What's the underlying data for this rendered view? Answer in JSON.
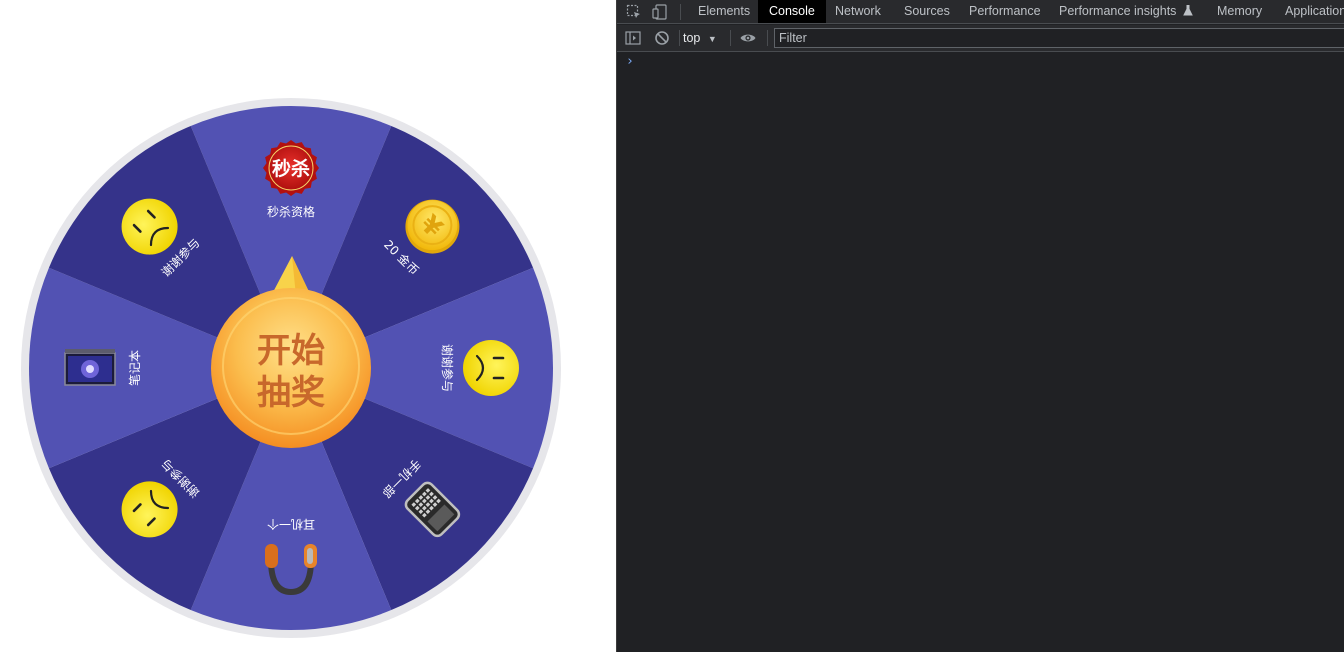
{
  "wheel": {
    "start_button_line1": "开始",
    "start_button_line2": "抽奖",
    "prizes": [
      {
        "label": "秒杀资格",
        "icon": "miaosha-badge-icon",
        "badge_text": "秒杀"
      },
      {
        "label": "20 金币",
        "icon": "gold-coin-icon",
        "coin_symbol": "¥"
      },
      {
        "label": "谢谢参与",
        "icon": "sad-face-icon"
      },
      {
        "label": "手机一部",
        "icon": "phone-icon"
      },
      {
        "label": "耳机一个",
        "icon": "headphones-icon"
      },
      {
        "label": "谢谢参与",
        "icon": "sad-face-icon"
      },
      {
        "label": "笔记本",
        "icon": "laptop-icon"
      },
      {
        "label": "谢谢参与",
        "icon": "sad-face-icon"
      }
    ],
    "colors": {
      "sector_light": "#5252b3",
      "sector_dark": "#35338a",
      "rim": "#e6e6ea",
      "button_orange": "#f9a53b",
      "button_text": "#c8682b"
    }
  },
  "devtools": {
    "tabs": [
      "Elements",
      "Console",
      "Network",
      "Sources",
      "Performance",
      "Performance insights",
      "Memory",
      "Application"
    ],
    "active_tab": "Console",
    "context": "top",
    "filter_placeholder": "Filter",
    "prompt_symbol": "›"
  }
}
